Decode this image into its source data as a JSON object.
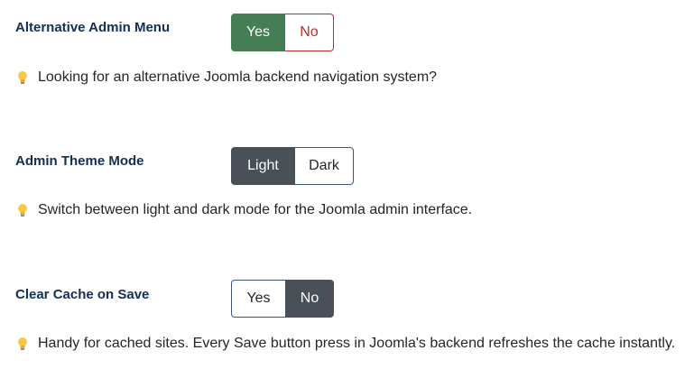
{
  "settings": [
    {
      "label": "Alternative Admin Menu",
      "options": [
        "Yes",
        "No"
      ],
      "selected": "Yes",
      "hint": "Looking for an alternative Joomla backend navigation system?",
      "hint_icon": "lightbulb-icon"
    },
    {
      "label": "Admin Theme Mode",
      "options": [
        "Light",
        "Dark"
      ],
      "selected": "Light",
      "hint": "Switch between light and dark mode for the Joomla admin interface.",
      "hint_icon": "lightbulb-icon"
    },
    {
      "label": "Clear Cache on Save",
      "options": [
        "Yes",
        "No"
      ],
      "selected": "No",
      "hint": "Handy for cached sites. Every Save button press in Joomla's backend refreshes the cache instantly.",
      "hint_icon": "lightbulb-icon"
    }
  ],
  "colors": {
    "label": "#132f53",
    "yes_active": "#457d54",
    "no_inactive_text": "#c52827",
    "no_inactive_border": "#c52827",
    "dark_active": "#495057",
    "inactive_border": "#495057",
    "neutral_inactive_border": "#3b5878"
  }
}
